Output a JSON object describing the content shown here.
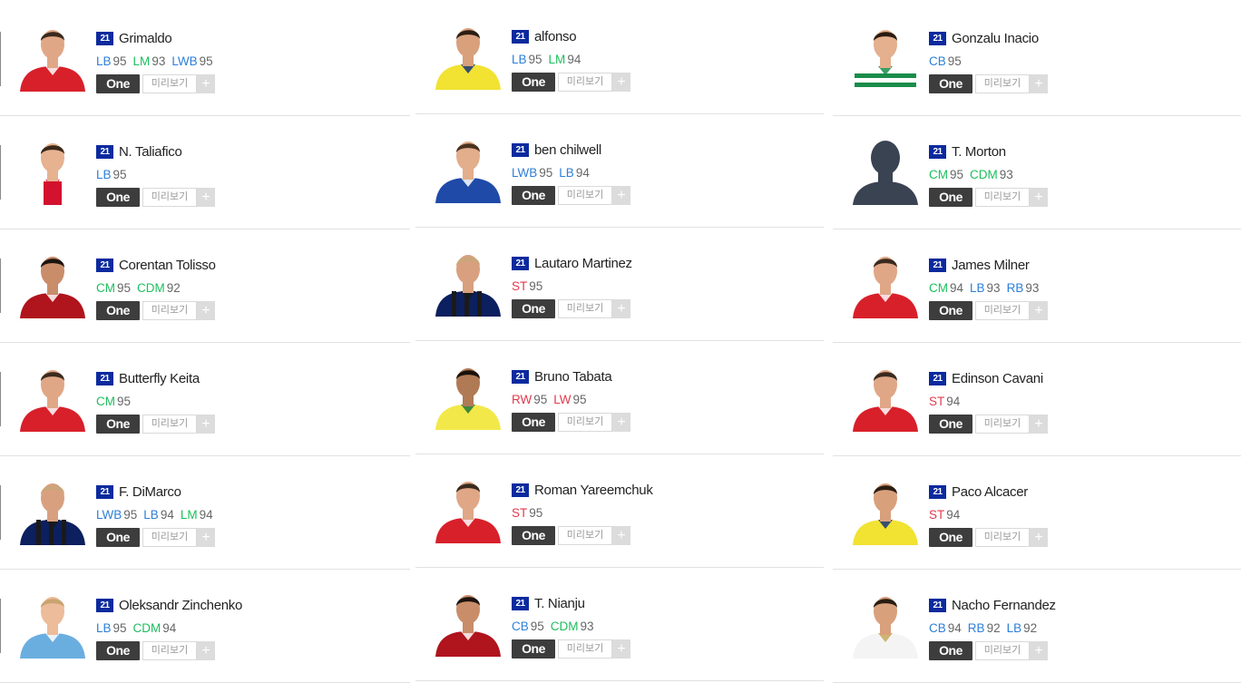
{
  "ui": {
    "season_badge": "21",
    "one_label": "One",
    "preview_label": "미리보기",
    "plus_label": "+"
  },
  "colors": {
    "FW": "#e23a4d",
    "MF": "#1cbf5c",
    "DF": "#2d7fd8",
    "season": "#0b2a9e"
  },
  "columns": [
    {
      "players": [
        {
          "name": "Grimaldo",
          "positions": [
            {
              "pos": "LB",
              "ovr": "95",
              "type": "DF"
            },
            {
              "pos": "LM",
              "ovr": "93",
              "type": "MF"
            },
            {
              "pos": "LWB",
              "ovr": "95",
              "type": "DF"
            }
          ],
          "kit": "red"
        },
        {
          "name": "N. Taliafico",
          "positions": [
            {
              "pos": "LB",
              "ovr": "95",
              "type": "DF"
            }
          ],
          "kit": "ajax"
        },
        {
          "name": "Corentan Tolisso",
          "positions": [
            {
              "pos": "CM",
              "ovr": "95",
              "type": "MF"
            },
            {
              "pos": "CDM",
              "ovr": "92",
              "type": "MF"
            }
          ],
          "kit": "darkred"
        },
        {
          "name": "Butterfly Keita",
          "positions": [
            {
              "pos": "CM",
              "ovr": "95",
              "type": "MF"
            }
          ],
          "kit": "red"
        },
        {
          "name": "F. DiMarco",
          "positions": [
            {
              "pos": "LWB",
              "ovr": "95",
              "type": "DF"
            },
            {
              "pos": "LB",
              "ovr": "94",
              "type": "DF"
            },
            {
              "pos": "LM",
              "ovr": "94",
              "type": "MF"
            }
          ],
          "kit": "inter"
        },
        {
          "name": "Oleksandr Zinchenko",
          "positions": [
            {
              "pos": "LB",
              "ovr": "95",
              "type": "DF"
            },
            {
              "pos": "CDM",
              "ovr": "94",
              "type": "MF"
            }
          ],
          "kit": "skyblue"
        }
      ]
    },
    {
      "players": [
        {
          "name": "alfonso",
          "positions": [
            {
              "pos": "LB",
              "ovr": "95",
              "type": "DF"
            },
            {
              "pos": "LM",
              "ovr": "94",
              "type": "MF"
            }
          ],
          "kit": "yellow"
        },
        {
          "name": "ben chilwell",
          "positions": [
            {
              "pos": "LWB",
              "ovr": "95",
              "type": "DF"
            },
            {
              "pos": "LB",
              "ovr": "94",
              "type": "DF"
            }
          ],
          "kit": "blue"
        },
        {
          "name": "Lautaro Martinez",
          "positions": [
            {
              "pos": "ST",
              "ovr": "95",
              "type": "FW"
            }
          ],
          "kit": "inter"
        },
        {
          "name": "Bruno Tabata",
          "positions": [
            {
              "pos": "RW",
              "ovr": "95",
              "type": "FW"
            },
            {
              "pos": "LW",
              "ovr": "95",
              "type": "FW"
            }
          ],
          "kit": "green"
        },
        {
          "name": "Roman Yareemchuk",
          "positions": [
            {
              "pos": "ST",
              "ovr": "95",
              "type": "FW"
            }
          ],
          "kit": "red"
        },
        {
          "name": "T. Nianju",
          "positions": [
            {
              "pos": "CB",
              "ovr": "95",
              "type": "DF"
            },
            {
              "pos": "CDM",
              "ovr": "93",
              "type": "MF"
            }
          ],
          "kit": "darkred"
        }
      ]
    },
    {
      "players": [
        {
          "name": "Gonzalu Inacio",
          "positions": [
            {
              "pos": "CB",
              "ovr": "95",
              "type": "DF"
            }
          ],
          "kit": "sporting"
        },
        {
          "name": "T. Morton",
          "positions": [
            {
              "pos": "CM",
              "ovr": "95",
              "type": "MF"
            },
            {
              "pos": "CDM",
              "ovr": "93",
              "type": "MF"
            }
          ],
          "kit": "silhouette"
        },
        {
          "name": "James Milner",
          "positions": [
            {
              "pos": "CM",
              "ovr": "94",
              "type": "MF"
            },
            {
              "pos": "LB",
              "ovr": "93",
              "type": "DF"
            },
            {
              "pos": "RB",
              "ovr": "93",
              "type": "DF"
            }
          ],
          "kit": "red"
        },
        {
          "name": "Edinson Cavani",
          "positions": [
            {
              "pos": "ST",
              "ovr": "94",
              "type": "FW"
            }
          ],
          "kit": "red"
        },
        {
          "name": "Paco Alcacer",
          "positions": [
            {
              "pos": "ST",
              "ovr": "94",
              "type": "FW"
            }
          ],
          "kit": "yellow"
        },
        {
          "name": "Nacho Fernandez",
          "positions": [
            {
              "pos": "CB",
              "ovr": "94",
              "type": "DF"
            },
            {
              "pos": "RB",
              "ovr": "92",
              "type": "DF"
            },
            {
              "pos": "LB",
              "ovr": "92",
              "type": "DF"
            }
          ],
          "kit": "white"
        }
      ]
    }
  ]
}
